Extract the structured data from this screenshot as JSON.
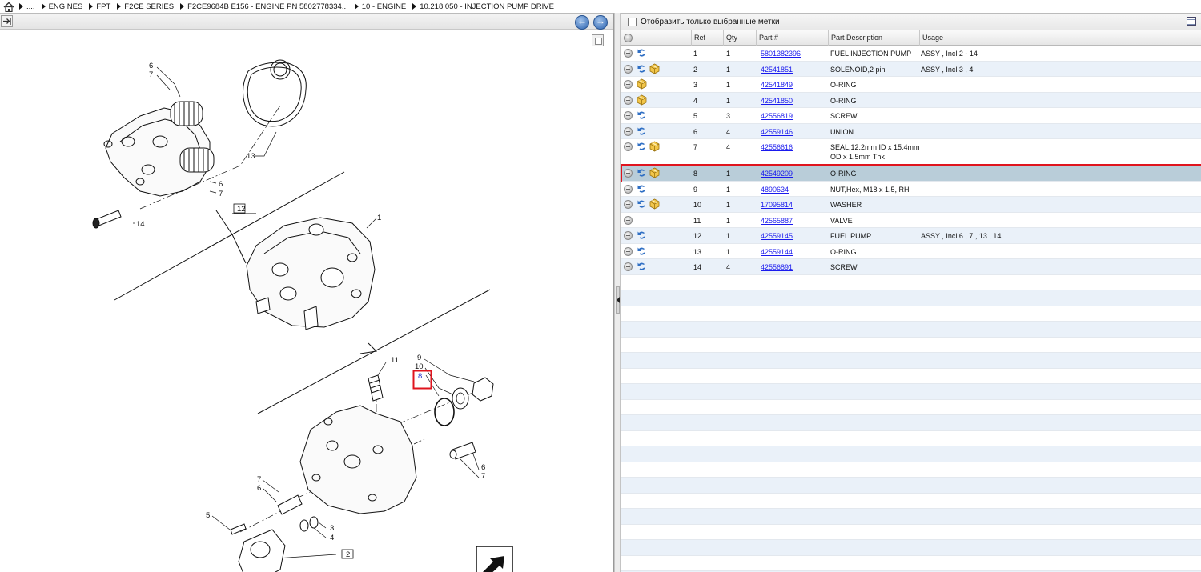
{
  "breadcrumb": {
    "items": [
      "....",
      "ENGINES",
      "FPT",
      "F2CE SERIES",
      "F2CE9684B E156 - ENGINE PN 5802778334...",
      "10 - ENGINE",
      "10.218.050 - INJECTION PUMP DRIVE"
    ]
  },
  "left_toolbar": {
    "back_symbol": "←",
    "forward_symbol": "→"
  },
  "drawing": {
    "callouts": [
      "6",
      "7",
      "13",
      "6",
      "7",
      "12",
      "14",
      "1",
      "11",
      "9",
      "10",
      "8",
      "6",
      "7",
      "7",
      "6",
      "5",
      "3",
      "4",
      "2"
    ]
  },
  "filter": {
    "label": "Отобразить только выбранные метки"
  },
  "table": {
    "headers": [
      "Ref",
      "Qty",
      "Part #",
      "Part Description",
      "Usage"
    ],
    "rows": [
      {
        "ref": "1",
        "qty": "1",
        "part": "5801382396",
        "desc": "FUEL INJECTION PUMP",
        "desc2": "",
        "usage": "ASSY , Incl 2 - 14",
        "link_icon": true,
        "pkg_icon": false,
        "selected": false
      },
      {
        "ref": "2",
        "qty": "1",
        "part": "42541851",
        "desc": "SOLENOID,2 pin",
        "desc2": "",
        "usage": "ASSY , Incl 3 , 4",
        "link_icon": true,
        "pkg_icon": true,
        "selected": false
      },
      {
        "ref": "3",
        "qty": "1",
        "part": "42541849",
        "desc": "O-RING",
        "desc2": "",
        "usage": "",
        "link_icon": false,
        "pkg_icon": true,
        "selected": false
      },
      {
        "ref": "4",
        "qty": "1",
        "part": "42541850",
        "desc": "O-RING",
        "desc2": "",
        "usage": "",
        "link_icon": false,
        "pkg_icon": true,
        "selected": false
      },
      {
        "ref": "5",
        "qty": "3",
        "part": "42556819",
        "desc": "SCREW",
        "desc2": "",
        "usage": "",
        "link_icon": true,
        "pkg_icon": false,
        "selected": false
      },
      {
        "ref": "6",
        "qty": "4",
        "part": "42559146",
        "desc": "UNION",
        "desc2": "",
        "usage": "",
        "link_icon": true,
        "pkg_icon": false,
        "selected": false
      },
      {
        "ref": "7",
        "qty": "4",
        "part": "42556616",
        "desc": "SEAL,12.2mm ID x 15.4mm",
        "desc2": "OD x 1.5mm Thk",
        "usage": "",
        "link_icon": true,
        "pkg_icon": true,
        "selected": false
      },
      {
        "ref": "8",
        "qty": "1",
        "part": "42549209",
        "desc": "O-RING",
        "desc2": "",
        "usage": "",
        "link_icon": true,
        "pkg_icon": true,
        "selected": true
      },
      {
        "ref": "9",
        "qty": "1",
        "part": "4890634",
        "desc": "NUT,Hex, M18 x 1.5, RH",
        "desc2": "",
        "usage": "",
        "link_icon": true,
        "pkg_icon": false,
        "selected": false
      },
      {
        "ref": "10",
        "qty": "1",
        "part": "17095814",
        "desc": "WASHER",
        "desc2": "",
        "usage": "",
        "link_icon": true,
        "pkg_icon": true,
        "selected": false
      },
      {
        "ref": "11",
        "qty": "1",
        "part": "42565887",
        "desc": "VALVE",
        "desc2": "",
        "usage": "",
        "link_icon": false,
        "pkg_icon": false,
        "selected": false
      },
      {
        "ref": "12",
        "qty": "1",
        "part": "42559145",
        "desc": "FUEL PUMP",
        "desc2": "",
        "usage": "ASSY , Incl 6 , 7 , 13 , 14",
        "link_icon": true,
        "pkg_icon": false,
        "selected": false
      },
      {
        "ref": "13",
        "qty": "1",
        "part": "42559144",
        "desc": "O-RING",
        "desc2": "",
        "usage": "",
        "link_icon": true,
        "pkg_icon": false,
        "selected": false
      },
      {
        "ref": "14",
        "qty": "4",
        "part": "42556891",
        "desc": "SCREW",
        "desc2": "",
        "usage": "",
        "link_icon": true,
        "pkg_icon": false,
        "selected": false
      }
    ]
  },
  "colors": {
    "selection_outline": "#e0141e",
    "selected_row": "#b9cdd9",
    "stripe_row": "#eaf1f9",
    "link": "#1a1aee"
  }
}
